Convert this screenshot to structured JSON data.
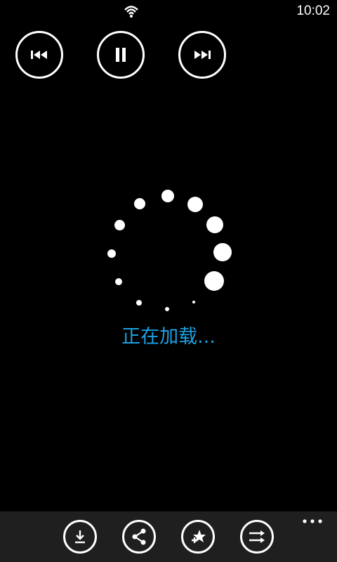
{
  "status": {
    "time": "10:02",
    "signal_icon": "wifi-icon"
  },
  "media": {
    "prev_icon": "skip-previous-icon",
    "pause_icon": "pause-icon",
    "next_icon": "skip-next-icon"
  },
  "loading": {
    "text": "正在加载...",
    "text_color": "#1ba1e2"
  },
  "app_bar": {
    "buttons": [
      {
        "icon": "download-icon"
      },
      {
        "icon": "share-icon"
      },
      {
        "icon": "rate-star-icon"
      },
      {
        "icon": "shuffle-icon"
      }
    ],
    "more_icon": "more-dots-icon",
    "background": "#1f1f1f"
  }
}
